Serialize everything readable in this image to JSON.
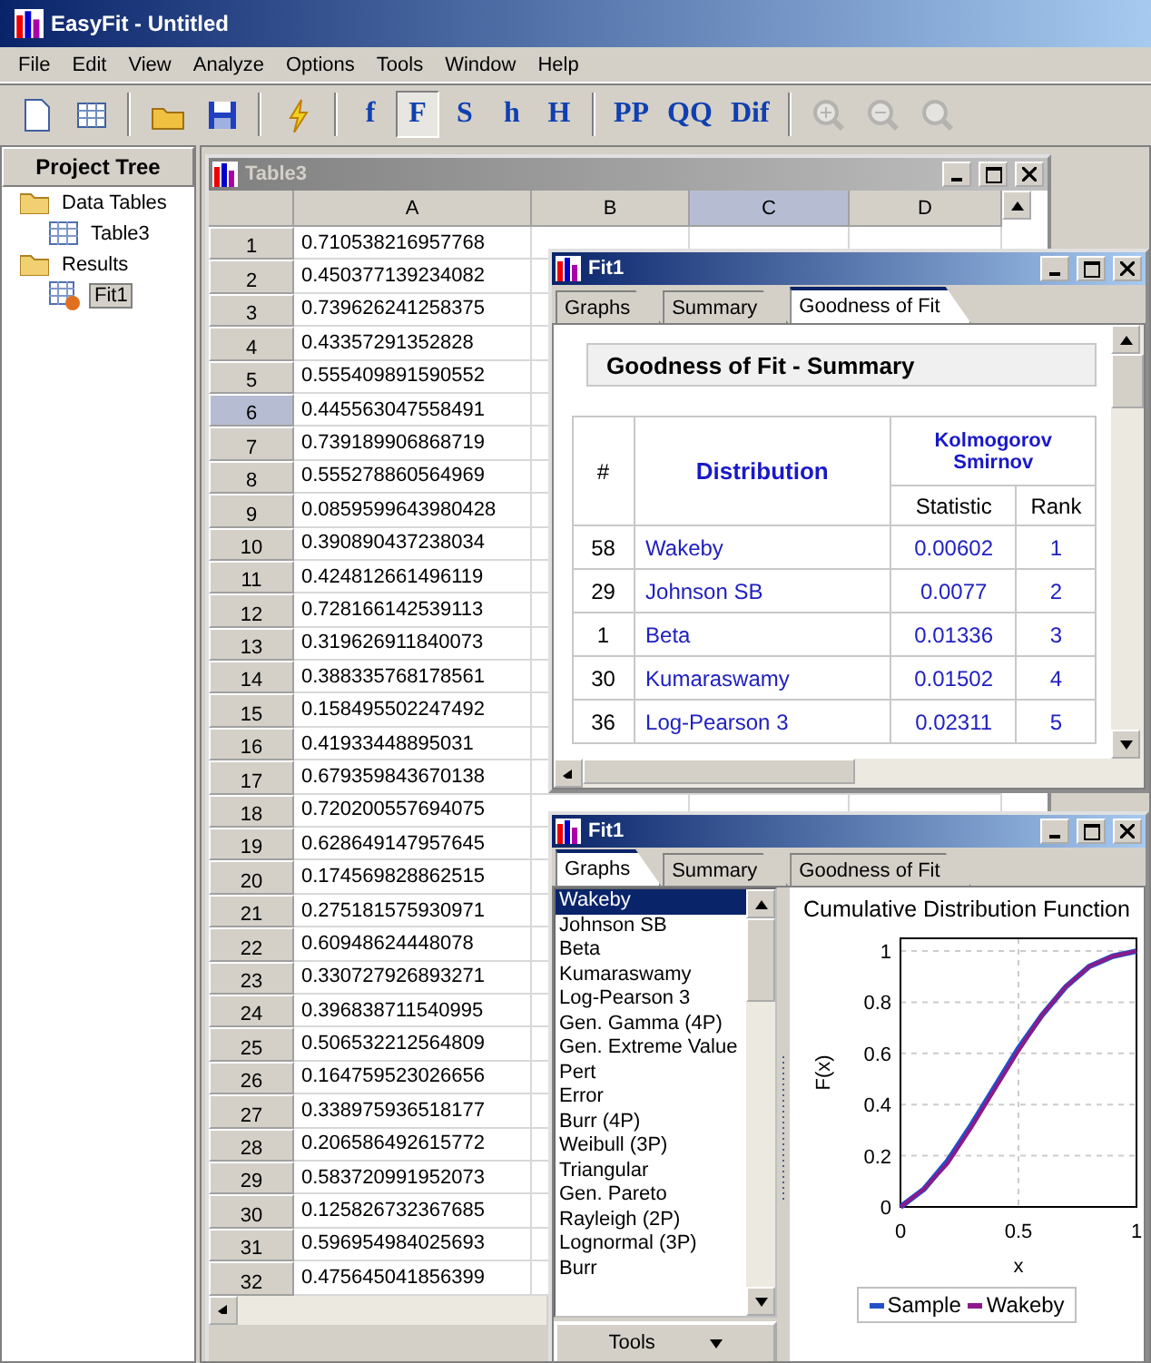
{
  "window": {
    "title": "EasyFit - Untitled"
  },
  "menu": [
    "File",
    "Edit",
    "View",
    "Analyze",
    "Options",
    "Tools",
    "Window",
    "Help"
  ],
  "toolbar": [
    {
      "kind": "icon",
      "disabled": false
    },
    {
      "kind": "icon",
      "disabled": false
    },
    {
      "kind": "separator"
    },
    {
      "kind": "icon",
      "disabled": false
    },
    {
      "kind": "icon",
      "disabled": false
    },
    {
      "kind": "separator"
    },
    {
      "kind": "icon",
      "disabled": false
    },
    {
      "kind": "separator"
    },
    {
      "kind": "text",
      "label": "f",
      "pressed": false
    },
    {
      "kind": "text",
      "label": "F",
      "pressed": true
    },
    {
      "kind": "text",
      "label": "S",
      "pressed": false
    },
    {
      "kind": "text",
      "label": "h",
      "pressed": false
    },
    {
      "kind": "text",
      "label": "H",
      "pressed": false
    },
    {
      "kind": "separator"
    },
    {
      "kind": "text",
      "label": "PP",
      "pressed": false
    },
    {
      "kind": "text",
      "label": "QQ",
      "pressed": false
    },
    {
      "kind": "text",
      "label": "Dif",
      "pressed": false
    },
    {
      "kind": "separator"
    },
    {
      "kind": "icon",
      "disabled": true
    },
    {
      "kind": "icon",
      "disabled": true
    },
    {
      "kind": "icon",
      "disabled": true
    }
  ],
  "project_tree": {
    "header": "Project Tree",
    "items": [
      {
        "label": "Data Tables",
        "selected": false,
        "children": [
          {
            "label": "Table3",
            "selected": false
          }
        ]
      },
      {
        "label": "Results",
        "selected": false,
        "children": [
          {
            "label": "Fit1",
            "selected": true
          }
        ]
      }
    ]
  },
  "table_window": {
    "title": "Table3",
    "columns": [
      {
        "label": "A",
        "selected": false
      },
      {
        "label": "B",
        "selected": false
      },
      {
        "label": "C",
        "selected": true
      },
      {
        "label": "D",
        "selected": false
      }
    ],
    "rows": [
      {
        "number": "1",
        "value": "0.710538216957768",
        "selected": false
      },
      {
        "number": "2",
        "value": "0.450377139234082",
        "selected": false
      },
      {
        "number": "3",
        "value": "0.739626241258375",
        "selected": false
      },
      {
        "number": "4",
        "value": "0.43357291352828",
        "selected": false
      },
      {
        "number": "5",
        "value": "0.555409891590552",
        "selected": false
      },
      {
        "number": "6",
        "value": "0.445563047558491",
        "selected": true
      },
      {
        "number": "7",
        "value": "0.739189906868719",
        "selected": false
      },
      {
        "number": "8",
        "value": "0.555278860564969",
        "selected": false
      },
      {
        "number": "9",
        "value": "0.0859599643980428",
        "selected": false
      },
      {
        "number": "10",
        "value": "0.390890437238034",
        "selected": false
      },
      {
        "number": "11",
        "value": "0.424812661496119",
        "selected": false
      },
      {
        "number": "12",
        "value": "0.728166142539113",
        "selected": false
      },
      {
        "number": "13",
        "value": "0.319626911840073",
        "selected": false
      },
      {
        "number": "14",
        "value": "0.388335768178561",
        "selected": false
      },
      {
        "number": "15",
        "value": "0.158495502247492",
        "selected": false
      },
      {
        "number": "16",
        "value": "0.41933448895031",
        "selected": false
      },
      {
        "number": "17",
        "value": "0.679359843670138",
        "selected": false
      },
      {
        "number": "18",
        "value": "0.720200557694075",
        "selected": false
      },
      {
        "number": "19",
        "value": "0.628649147957645",
        "selected": false
      },
      {
        "number": "20",
        "value": "0.174569828862515",
        "selected": false
      },
      {
        "number": "21",
        "value": "0.275181575930971",
        "selected": false
      },
      {
        "number": "22",
        "value": "0.60948624448078",
        "selected": false
      },
      {
        "number": "23",
        "value": "0.330727926893271",
        "selected": false
      },
      {
        "number": "24",
        "value": "0.396838711540995",
        "selected": false
      },
      {
        "number": "25",
        "value": "0.506532212564809",
        "selected": false
      },
      {
        "number": "26",
        "value": "0.164759523026656",
        "selected": false
      },
      {
        "number": "27",
        "value": "0.338975936518177",
        "selected": false
      },
      {
        "number": "28",
        "value": "0.206586492615772",
        "selected": false
      },
      {
        "number": "29",
        "value": "0.583720991952073",
        "selected": false
      },
      {
        "number": "30",
        "value": "0.125826732367685",
        "selected": false
      },
      {
        "number": "31",
        "value": "0.596954984025693",
        "selected": false
      },
      {
        "number": "32",
        "value": "0.475645041856399",
        "selected": false
      }
    ]
  },
  "fit_windows": [
    {
      "title": "Fit1",
      "tabs": [
        {
          "label": "Graphs",
          "selected": false
        },
        {
          "label": "Summary",
          "selected": false
        },
        {
          "label": "Goodness of Fit",
          "selected": true
        }
      ],
      "content": {
        "kind": "goodness",
        "heading": "Goodness of Fit - Summary",
        "group_header": "Kolmogorov Smirnov",
        "columns": [
          "#",
          "Distribution",
          "Statistic",
          "Rank"
        ],
        "rows": [
          {
            "number": "58",
            "distribution": "Wakeby",
            "statistic": "0.00602",
            "rank": "1"
          },
          {
            "number": "29",
            "distribution": "Johnson SB",
            "statistic": "0.0077",
            "rank": "2"
          },
          {
            "number": "1",
            "distribution": "Beta",
            "statistic": "0.01336",
            "rank": "3"
          },
          {
            "number": "30",
            "distribution": "Kumaraswamy",
            "statistic": "0.01502",
            "rank": "4"
          },
          {
            "number": "36",
            "distribution": "Log-Pearson 3",
            "statistic": "0.02311",
            "rank": "5"
          }
        ]
      }
    },
    {
      "title": "Fit1",
      "tabs": [
        {
          "label": "Graphs",
          "selected": true
        },
        {
          "label": "Summary",
          "selected": false
        },
        {
          "label": "Goodness of Fit",
          "selected": false
        }
      ],
      "content": {
        "kind": "graphs",
        "tools_button": "Tools",
        "distributions": [
          {
            "label": "Wakeby",
            "selected": true
          },
          {
            "label": "Johnson SB",
            "selected": false
          },
          {
            "label": "Beta",
            "selected": false
          },
          {
            "label": "Kumaraswamy",
            "selected": false
          },
          {
            "label": "Log-Pearson 3",
            "selected": false
          },
          {
            "label": "Gen. Gamma (4P)",
            "selected": false
          },
          {
            "label": "Gen. Extreme Value",
            "selected": false
          },
          {
            "label": "Pert",
            "selected": false
          },
          {
            "label": "Error",
            "selected": false
          },
          {
            "label": "Burr (4P)",
            "selected": false
          },
          {
            "label": "Weibull (3P)",
            "selected": false
          },
          {
            "label": "Triangular",
            "selected": false
          },
          {
            "label": "Gen. Pareto",
            "selected": false
          },
          {
            "label": "Rayleigh (2P)",
            "selected": false
          },
          {
            "label": "Lognormal (3P)",
            "selected": false
          },
          {
            "label": "Burr",
            "selected": false
          }
        ],
        "chart_data": {
          "type": "line",
          "title": "Cumulative Distribution Function",
          "xlabel": "x",
          "ylabel": "F(x)",
          "x": [
            0,
            0.1,
            0.2,
            0.3,
            0.4,
            0.5,
            0.6,
            0.7,
            0.8,
            0.9,
            1
          ],
          "series": [
            {
              "name": "Sample",
              "color": "#2050c8",
              "values": [
                0,
                0.07,
                0.18,
                0.32,
                0.47,
                0.62,
                0.75,
                0.86,
                0.94,
                0.98,
                1
              ]
            },
            {
              "name": "Wakeby",
              "color": "#8b1a8b",
              "values": [
                0,
                0.07,
                0.17,
                0.31,
                0.46,
                0.61,
                0.75,
                0.86,
                0.94,
                0.98,
                1
              ]
            }
          ],
          "grid": true,
          "legend": "bottom",
          "xlim": [
            0,
            1
          ],
          "ylim": [
            0,
            1.05
          ],
          "xticks": [
            0,
            0.5,
            1
          ],
          "yticks": [
            0,
            0.2,
            0.4,
            0.6,
            0.8,
            1
          ]
        }
      }
    }
  ]
}
